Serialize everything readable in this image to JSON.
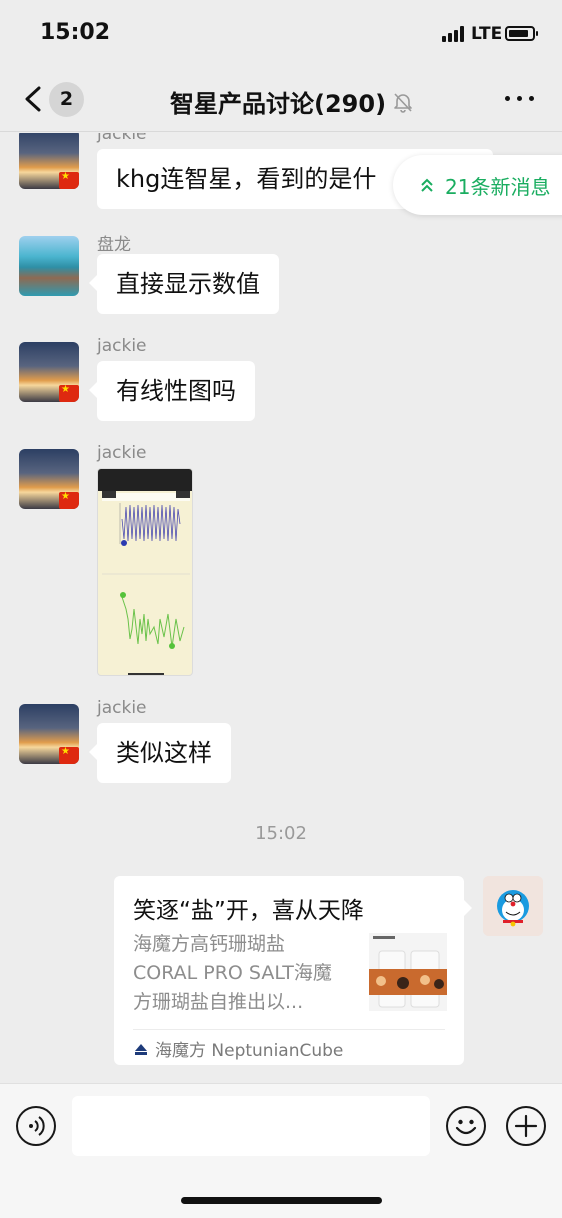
{
  "status_bar": {
    "time": "15:02",
    "network": "LTE"
  },
  "nav": {
    "unread_count": "2",
    "title": "智星产品讨论(290)"
  },
  "new_messages_pill": "21条新消息",
  "messages": [
    {
      "sender": "jackie",
      "text": "khg连智星，看到的是什"
    },
    {
      "sender": "盘龙",
      "text": "直接显示数值"
    },
    {
      "sender": "jackie",
      "text": "有线性图吗"
    },
    {
      "sender": "jackie",
      "type": "image"
    },
    {
      "sender": "jackie",
      "text": "类似这样"
    }
  ],
  "timestamp": "15:02",
  "link_card": {
    "title": "笑逐“盐”开，喜从天降",
    "description": "海魔方高钙珊瑚盐CORAL PRO SALT海魔方珊瑚盐自推出以...",
    "source": "海魔方 NeptunianCube"
  },
  "input": {
    "value": ""
  },
  "colors": {
    "accent_green": "#1aad60",
    "background": "#ededed",
    "flag_red": "#de2910"
  }
}
